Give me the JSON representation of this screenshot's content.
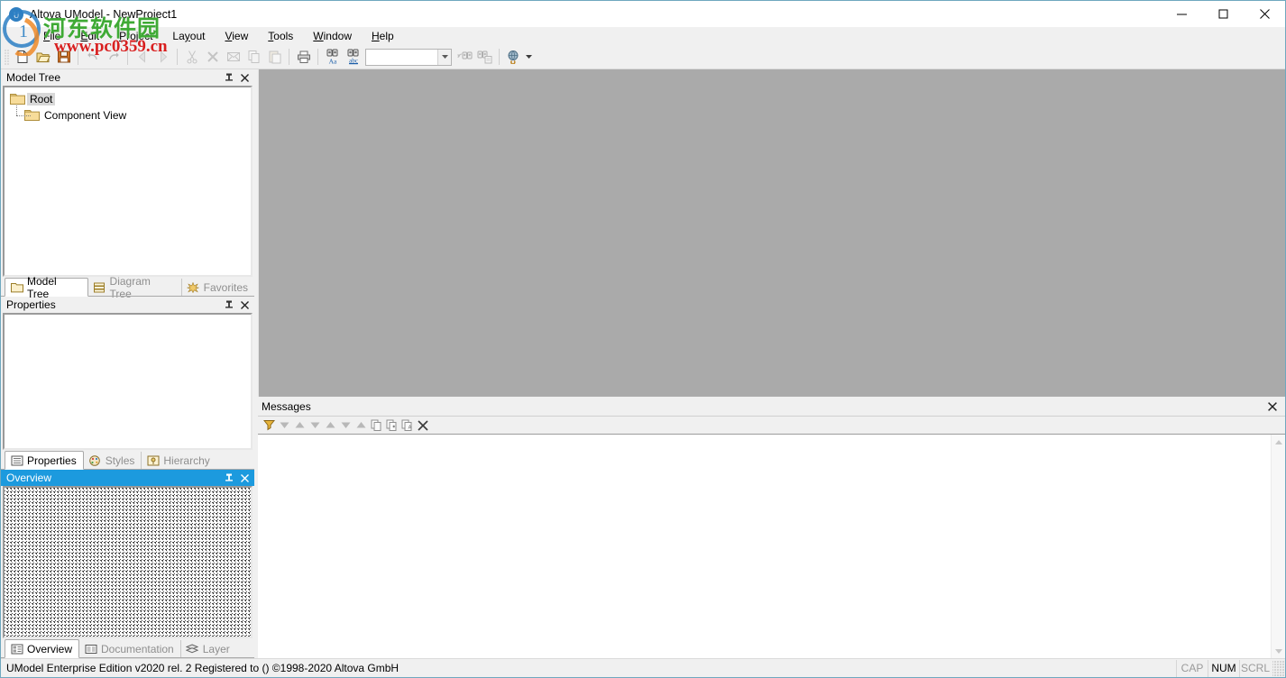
{
  "window": {
    "title": "Altova UModel - NewProject1",
    "app_icon": "umodel-app-icon",
    "minimize_label": "–",
    "maximize_label": "❐",
    "close_label": "✕"
  },
  "menubar": {
    "items": [
      {
        "pre": "",
        "accel": "F",
        "post": "ile",
        "name": "menu-file"
      },
      {
        "pre": "",
        "accel": "E",
        "post": "dit",
        "name": "menu-edit"
      },
      {
        "pre": "",
        "accel": "P",
        "post": "roject",
        "name": "menu-project"
      },
      {
        "pre": "La",
        "accel": "y",
        "post": "out",
        "name": "menu-layout"
      },
      {
        "pre": "",
        "accel": "V",
        "post": "iew",
        "name": "menu-view"
      },
      {
        "pre": "",
        "accel": "T",
        "post": "ools",
        "name": "menu-tools"
      },
      {
        "pre": "",
        "accel": "W",
        "post": "indow",
        "name": "menu-window"
      },
      {
        "pre": "",
        "accel": "H",
        "post": "elp",
        "name": "menu-help"
      }
    ]
  },
  "toolbar": {
    "buttons": [
      {
        "name": "new-file-icon",
        "glyph": "new",
        "disabled": false
      },
      {
        "name": "open-folder-icon",
        "glyph": "open",
        "disabled": false
      },
      {
        "name": "save-icon",
        "glyph": "save",
        "disabled": false
      },
      {
        "name": "undo-icon",
        "glyph": "undo",
        "disabled": true
      },
      {
        "name": "redo-icon",
        "glyph": "redo",
        "disabled": true
      },
      {
        "name": "back-icon",
        "glyph": "back",
        "disabled": true
      },
      {
        "name": "forward-icon",
        "glyph": "forward",
        "disabled": true
      },
      {
        "name": "cut-icon",
        "glyph": "cut",
        "disabled": true
      },
      {
        "name": "delete-icon",
        "glyph": "delete",
        "disabled": true
      },
      {
        "name": "cut-diagram-icon",
        "glyph": "envelope",
        "disabled": true
      },
      {
        "name": "copy-icon",
        "glyph": "copy",
        "disabled": true
      },
      {
        "name": "paste-icon",
        "glyph": "paste",
        "disabled": true
      },
      {
        "name": "print-icon",
        "glyph": "print",
        "disabled": false
      },
      {
        "name": "find-icon",
        "glyph": "find-aa",
        "disabled": false
      },
      {
        "name": "find-abc-icon",
        "glyph": "find-abc",
        "disabled": false
      },
      {
        "name": "find-previous-icon",
        "glyph": "find-prev",
        "disabled": true
      },
      {
        "name": "find-next-icon",
        "glyph": "find-next",
        "disabled": true
      },
      {
        "name": "hyperlink-icon",
        "glyph": "globe",
        "disabled": false
      }
    ],
    "search_combo": {
      "value": "",
      "placeholder": ""
    }
  },
  "model_tree_panel": {
    "title": "Model Tree",
    "active": false,
    "pin_glyph": "📌",
    "close_glyph": "✕",
    "tree": {
      "root": {
        "label": "Root",
        "icon": "folder-icon",
        "selected": true
      },
      "children": [
        {
          "label": "Component View",
          "icon": "folder-icon",
          "selected": false
        }
      ]
    },
    "tabs": [
      {
        "label": "Model Tree",
        "icon": "folder-tab-icon",
        "active": true,
        "name": "tab-model-tree"
      },
      {
        "label": "Diagram Tree",
        "icon": "diagram-tab-icon",
        "active": false,
        "name": "tab-diagram-tree"
      },
      {
        "label": "Favorites",
        "icon": "favorites-tab-icon",
        "active": false,
        "name": "tab-favorites"
      }
    ]
  },
  "properties_panel": {
    "title": "Properties",
    "active": false,
    "pin_glyph": "📌",
    "close_glyph": "✕",
    "content": "",
    "tabs": [
      {
        "label": "Properties",
        "icon": "properties-tab-icon",
        "active": true,
        "name": "tab-properties"
      },
      {
        "label": "Styles",
        "icon": "styles-tab-icon",
        "active": false,
        "name": "tab-styles"
      },
      {
        "label": "Hierarchy",
        "icon": "hierarchy-tab-icon",
        "active": false,
        "name": "tab-hierarchy"
      }
    ]
  },
  "overview_panel": {
    "title": "Overview",
    "active": true,
    "pin_glyph": "📌",
    "close_glyph": "✕",
    "tabs": [
      {
        "label": "Overview",
        "icon": "overview-tab-icon",
        "active": true,
        "name": "tab-overview"
      },
      {
        "label": "Documentation",
        "icon": "documentation-tab-icon",
        "active": false,
        "name": "tab-documentation"
      },
      {
        "label": "Layer",
        "icon": "layer-tab-icon",
        "active": false,
        "name": "tab-layer"
      }
    ]
  },
  "messages_panel": {
    "title": "Messages",
    "close_glyph": "✕",
    "content": "",
    "toolbar": [
      {
        "name": "filter-icon",
        "glyph": "funnel"
      },
      {
        "name": "next-message-icon",
        "glyph": "down"
      },
      {
        "name": "previous-message-icon",
        "glyph": "up"
      },
      {
        "name": "next-error-icon",
        "glyph": "down"
      },
      {
        "name": "previous-error-icon",
        "glyph": "up"
      },
      {
        "name": "next-warning-icon",
        "glyph": "down"
      },
      {
        "name": "previous-warning-icon",
        "glyph": "up"
      },
      {
        "name": "copy-message-icon",
        "glyph": "copy1"
      },
      {
        "name": "copy-message-child-icon",
        "glyph": "copy2"
      },
      {
        "name": "copy-message-all-icon",
        "glyph": "copy3"
      },
      {
        "name": "clear-messages-icon",
        "glyph": "close"
      }
    ]
  },
  "statusbar": {
    "text": "UModel Enterprise Edition v2020 rel. 2   Registered to  ()   ©1998-2020 Altova GmbH",
    "indicators": [
      {
        "label": "CAP",
        "on": false,
        "name": "status-caps-lock"
      },
      {
        "label": "NUM",
        "on": true,
        "name": "status-num-lock"
      },
      {
        "label": "SCRL",
        "on": false,
        "name": "status-scroll-lock"
      }
    ]
  },
  "watermark": {
    "cn_text": "河东软件园",
    "url_text": "www.pc0359.cn",
    "cn_color": "#3faa35",
    "url_color": "#d81f1f"
  },
  "colors": {
    "titlebar_bg": "#ffffff",
    "chrome_bg": "#f0f0f0",
    "mdi_bg": "#aaaaaa",
    "active_panel_title": "#1c9ade",
    "panel_white": "#ffffff",
    "border": "#a0a0a0",
    "disabled_text": "#8e8e8e"
  }
}
